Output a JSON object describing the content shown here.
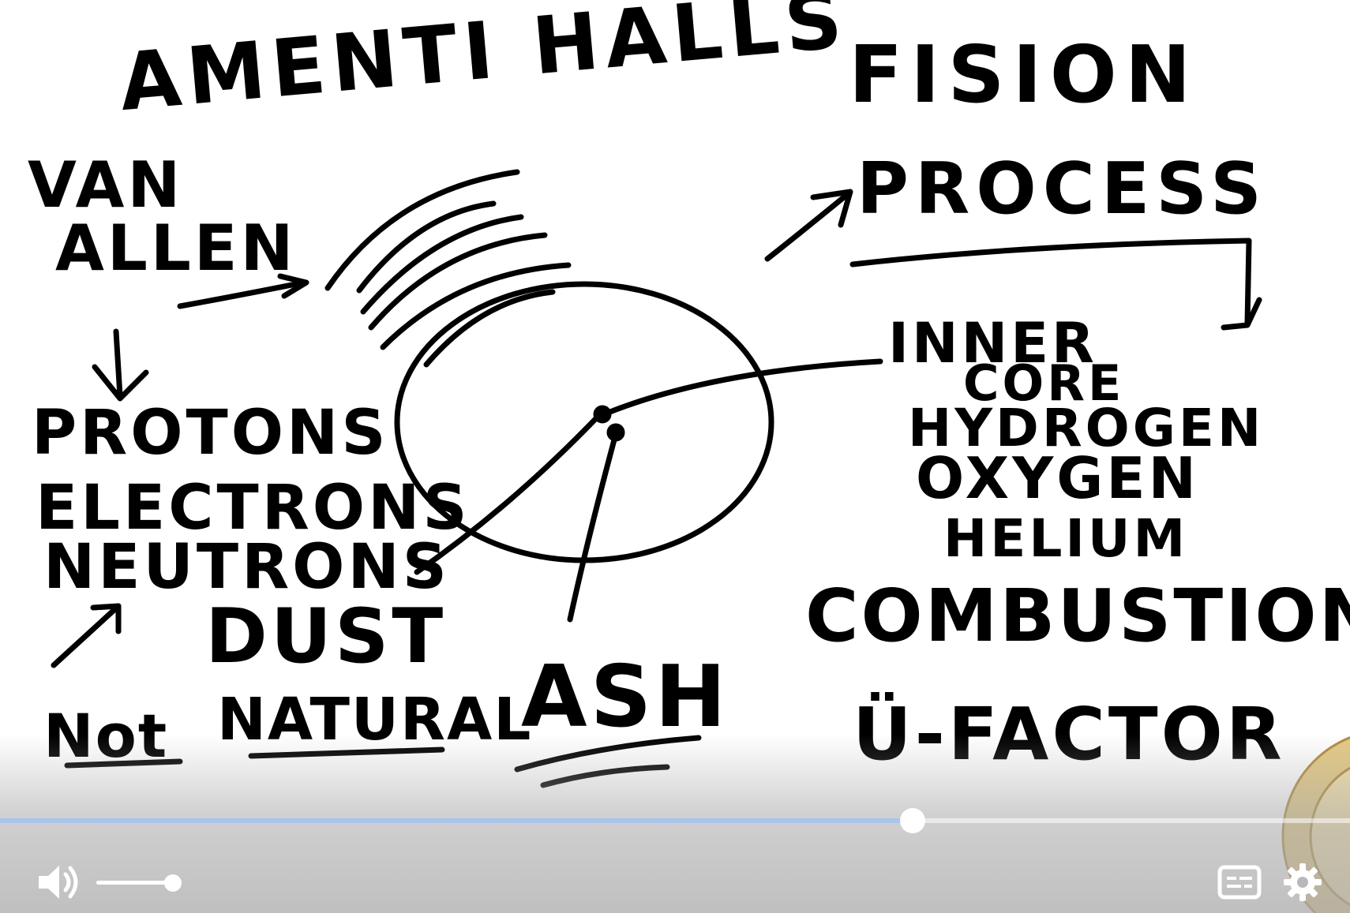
{
  "whiteboard": {
    "title": "AMENTI HALLS",
    "left_column": {
      "belt_label": [
        "VAN",
        "ALLEN"
      ],
      "particles": [
        "PROTONS",
        "ELECTRONS",
        "NEUTRONS",
        "DUST"
      ]
    },
    "right_column": {
      "process_label": [
        "FISION",
        "PROCESS"
      ],
      "core_label": [
        "INNER",
        "CORE"
      ],
      "elements": [
        "HYDROGEN",
        "OXYGEN",
        "HELIUM"
      ],
      "combustion": "COMBUSTION",
      "factor": "Ü-FACTOR"
    },
    "bottom_text": {
      "not": "Not",
      "natural": "NATURAL",
      "ash": "ASH"
    }
  },
  "player": {
    "progress": 0.676,
    "volume": 0.9,
    "colors": {
      "progress_fill": "#a8c4ec",
      "controls": "#ffffff"
    },
    "controls": {
      "volume_icon": "volume-icon",
      "captions_icon": "captions-icon",
      "settings_icon": "gear-icon"
    }
  }
}
